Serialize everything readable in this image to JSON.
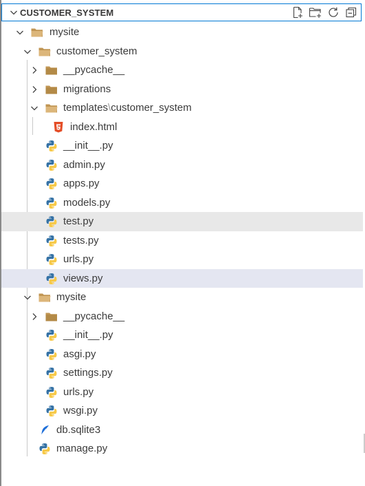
{
  "header": {
    "title": "CUSTOMER_SYSTEM",
    "actions": [
      {
        "name": "new-file-icon"
      },
      {
        "name": "new-folder-icon"
      },
      {
        "name": "refresh-icon"
      },
      {
        "name": "collapse-all-icon"
      }
    ]
  },
  "tree": {
    "root": "mysite",
    "app": "customer_system",
    "pycache1": "__pycache__",
    "migrations": "migrations",
    "templates": "templates",
    "templates_sep": "\\",
    "templates_sub": "customer_system",
    "index": "index.html",
    "init1": "__init__.py",
    "admin": "admin.py",
    "apps": "apps.py",
    "models": "models.py",
    "test": "test.py",
    "tests": "tests.py",
    "urls1": "urls.py",
    "views": "views.py",
    "proj": "mysite",
    "pycache2": "__pycache__",
    "init2": "__init__.py",
    "asgi": "asgi.py",
    "settings": "settings.py",
    "urls2": "urls.py",
    "wsgi": "wsgi.py",
    "db": "db.sqlite3",
    "manage": "manage.py"
  },
  "colors": {
    "folder": "#c09553",
    "html": "#e44d26",
    "python_blue": "#3572a5",
    "python_yellow": "#f7c948",
    "focus_border": "#0078d4",
    "selected_row": "#e4e6f1",
    "hover_row": "#e8e8e8"
  }
}
